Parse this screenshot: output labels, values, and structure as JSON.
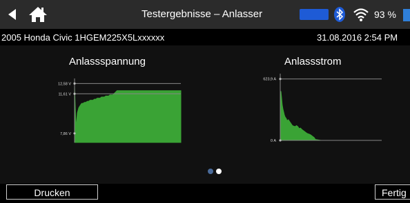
{
  "header": {
    "title": "Testergebnisse – Anlasser",
    "battery_percent": "93 %"
  },
  "info": {
    "vehicle": "2005 Honda Civic 1HGEM225X5Lxxxxxx",
    "datetime": "31.08.2016 2:54 PM"
  },
  "charts": {
    "voltage_title": "Anlassspannung",
    "current_title": "Anlassstrom",
    "voltage_ticks": [
      "12,58 V",
      "11,61 V",
      "7,86 V"
    ],
    "current_ticks": [
      "623,9 A",
      "0 A"
    ]
  },
  "chart_data": [
    {
      "type": "area",
      "title": "Anlassspannung",
      "color": "#3aa335",
      "y_ticks": [
        12.58,
        11.61,
        7.86
      ],
      "y_tick_labels": [
        "12,58 V",
        "11,61 V",
        "7,86 V"
      ],
      "reference_lines": [
        12.58,
        11.61
      ],
      "ylim": [
        7.0,
        12.8
      ],
      "x": [
        0,
        2,
        4,
        6,
        8,
        10,
        12,
        14,
        16,
        18,
        20,
        22,
        24,
        26,
        28,
        30,
        32,
        34,
        36,
        38,
        40,
        42,
        44,
        46,
        48,
        50,
        54,
        60,
        70,
        80,
        90,
        100,
        110,
        120,
        130,
        140,
        150
      ],
      "y": [
        12.3,
        8.4,
        9.8,
        10.3,
        10.5,
        10.7,
        10.7,
        10.8,
        10.8,
        10.9,
        10.9,
        11.0,
        11.0,
        11.0,
        11.1,
        11.1,
        11.2,
        11.2,
        11.2,
        11.3,
        11.3,
        11.3,
        11.4,
        11.4,
        11.4,
        11.5,
        11.5,
        11.9,
        11.9,
        11.9,
        11.9,
        11.9,
        11.9,
        11.9,
        11.9,
        11.9,
        11.9
      ]
    },
    {
      "type": "area",
      "title": "Anlassstrom",
      "color": "#3aa335",
      "y_ticks": [
        623.9,
        0
      ],
      "y_tick_labels": [
        "623,9 A",
        "0 A"
      ],
      "reference_lines": [
        623.9,
        0
      ],
      "ylim": [
        0,
        650
      ],
      "x": [
        0,
        1,
        2,
        3,
        4,
        5,
        6,
        7,
        8,
        9,
        10,
        12,
        14,
        16,
        18,
        20,
        22,
        24,
        26,
        28,
        30,
        32,
        34,
        36,
        38,
        40,
        42,
        44,
        46,
        48,
        50,
        52,
        60,
        80,
        100,
        120,
        140,
        150
      ],
      "y": [
        460,
        500,
        430,
        360,
        320,
        290,
        260,
        240,
        230,
        220,
        200,
        210,
        190,
        170,
        150,
        145,
        140,
        150,
        140,
        120,
        125,
        110,
        100,
        90,
        80,
        70,
        65,
        60,
        50,
        40,
        30,
        10,
        0,
        0,
        0,
        0,
        0,
        0
      ]
    }
  ],
  "pagination": {
    "total": 2,
    "active": 2
  },
  "buttons": {
    "print": "Drucken",
    "finish": "Fertig"
  }
}
